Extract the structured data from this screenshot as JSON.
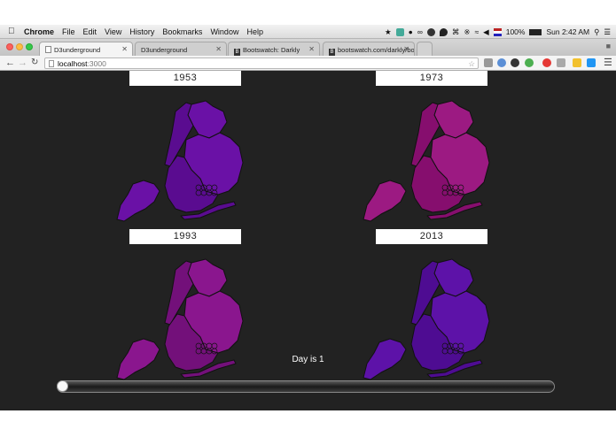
{
  "menubar": {
    "items": [
      "Chrome",
      "File",
      "Edit",
      "View",
      "History",
      "Bookmarks",
      "Window",
      "Help"
    ],
    "battery": "100%",
    "clock": "Sun 2:42 AM"
  },
  "tabs": [
    {
      "title": "D3underground",
      "active": true
    },
    {
      "title": "D3underground",
      "active": false
    },
    {
      "title": "Bootswatch: Darkly",
      "active": false
    },
    {
      "title": "bootswatch.com/darkly/bo",
      "active": false
    }
  ],
  "address": {
    "host": "localhost",
    "port": ":3000"
  },
  "maps": [
    {
      "year": "1953",
      "color": "#6a11a6",
      "shade": "#5a0c90"
    },
    {
      "year": "1973",
      "color": "#9c1a82",
      "shade": "#860e6e"
    },
    {
      "year": "1993",
      "color": "#8a168e",
      "shade": "#73107a"
    },
    {
      "year": "2013",
      "color": "#5d12a8",
      "shade": "#4e0c92"
    }
  ],
  "status": {
    "day_text": "Day is 1"
  },
  "slider": {
    "value": 1
  },
  "colors": {
    "background": "#222222",
    "label_bg": "#ffffff"
  }
}
